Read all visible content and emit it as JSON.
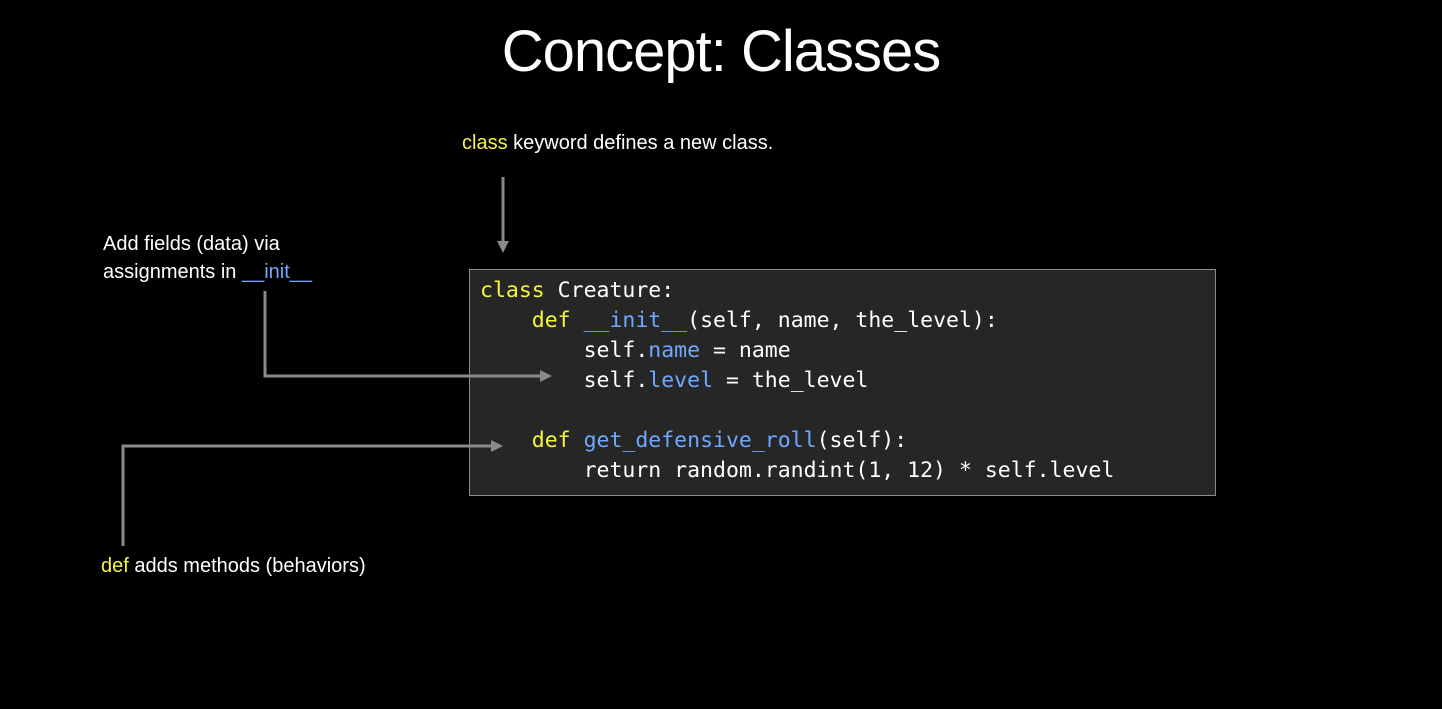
{
  "title": "Concept: Classes",
  "notes": {
    "class_note": {
      "keyword": "class",
      "text": " keyword defines a new class."
    },
    "fields_note": {
      "line1": "Add fields (data) via",
      "line2_prefix": "assignments in ",
      "init_word": "__init__"
    },
    "def_note": {
      "keyword": "def",
      "text": " adds methods (behaviors)"
    }
  },
  "code": {
    "line1": {
      "kw": "class",
      "rest": " Creature:"
    },
    "line2": {
      "indent": "    ",
      "kw": "def",
      "sp": " ",
      "fn": "__init__",
      "rest": "(self, name, the_level):"
    },
    "line3": {
      "indent": "        ",
      "pre": "self.",
      "field": "name",
      "rest": " = name"
    },
    "line4": {
      "indent": "        ",
      "pre": "self.",
      "field": "level",
      "rest": " = the_level"
    },
    "line6": {
      "indent": "    ",
      "kw": "def",
      "sp": " ",
      "fn": "get_defensive_roll",
      "rest": "(self):"
    },
    "line7": {
      "indent": "        ",
      "rest": "return random.randint(1, 12) * self.level"
    }
  },
  "colors": {
    "background": "#000000",
    "keyword": "#f5f542",
    "identifier": "#6fa8ff",
    "code_background": "#262626",
    "arrow": "#8a8a8a"
  }
}
